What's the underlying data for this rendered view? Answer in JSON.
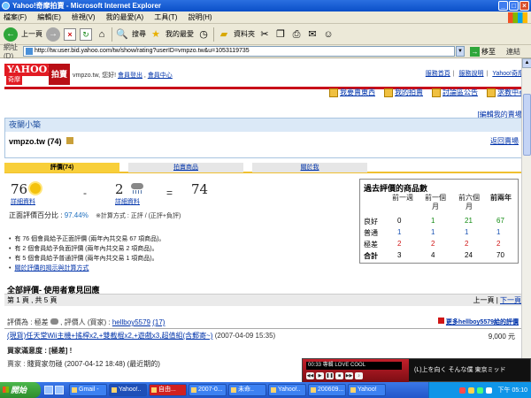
{
  "window": {
    "title": "Yahoo!奇摩拍賣 - Microsoft Internet Explorer",
    "menu": [
      "檔案(F)",
      "編輯(E)",
      "檢視(V)",
      "我的最愛(A)",
      "工具(T)",
      "說明(H)"
    ],
    "toolbar": {
      "back": "上一頁",
      "search": "搜尋",
      "favorites": "我的最愛",
      "history": "資料夾"
    },
    "address": {
      "label": "網址(D)",
      "url": "http://tw.user.bid.yahoo.com/tw/show/rating?userID=vmpzo.tw&u=1053119735",
      "go": "移至",
      "links": "連結"
    }
  },
  "header": {
    "logo_yahoo": "YAHOO!",
    "logo_kimo": "奇摩",
    "logo_auction": "拍賣",
    "hello_prefix": "vmpzo.tw, 您好!",
    "logout": "會員登出",
    "member_center": "會員中心",
    "top_links": [
      "服務首頁",
      "服務說明",
      "Yahoo!奇摩"
    ],
    "nav": [
      "我要賣東西",
      "我的拍賣",
      "討論區公告",
      "求教中心"
    ]
  },
  "store": {
    "edit_store": "[編輯我的賣場]",
    "name": "夜闌小築",
    "seller_id": "vmpzo.tw",
    "seller_score": "(74)",
    "back_link": "返回賣場"
  },
  "tabs": [
    "評價(74)",
    "拍賣商品",
    "關於我"
  ],
  "rating": {
    "positive": "76",
    "negative": "2",
    "total": "74",
    "minus": "-",
    "equals": "=",
    "detail_label": "詳細資料",
    "pct_label": "正面評價百分比 :",
    "pct_value": "97.44%",
    "formula": "※計算方式 : 正評 / (正評+負評)"
  },
  "bullets": [
    "有 76 個會員給予正面評價 (兩年內共交易 67 項商品)。",
    "有 2 個會員給予負面評價 (兩年內共交易 2 項商品)。",
    "有 5 個會員給予普通評價 (兩年內共交易 1 項商品)。",
    "關於評價的揭示與計算方式"
  ],
  "past": {
    "title": "過去評價的商品數",
    "headers": [
      "前一週",
      "前一個月",
      "前六個月",
      "前兩年"
    ],
    "rows": [
      {
        "label": "良好",
        "values": [
          "0",
          "1",
          "21",
          "67"
        ]
      },
      {
        "label": "普通",
        "values": [
          "1",
          "1",
          "1",
          "1"
        ]
      },
      {
        "label": "極差",
        "values": [
          "2",
          "2",
          "2",
          "2"
        ]
      },
      {
        "label": "合計",
        "values": [
          "3",
          "4",
          "24",
          "70"
        ]
      }
    ]
  },
  "reviews": {
    "section_title": "全部評價- 使用者意見回應",
    "pages": "第 1 頁 , 共 5 頁",
    "prev": "上一頁",
    "next": "下一頁",
    "rating_label": "評價為 :",
    "rating_value": "極差",
    "rater_label": ", 評價人 (買家) :",
    "buyer": "hellboy5579",
    "buyer_score": "(17)",
    "more_link": "更多hellboy5579給的評價",
    "item": "(現貨)任天堂Wii主機+搖桿x2,+雙截棍x2,+遊戲x3,超值組(含郵寄~)",
    "item_date": "(2007-04-09 15:35)",
    "price": "9,000 元",
    "satisfaction_label": "買家滿意度 :",
    "satisfaction_value": "[極差] !",
    "reply_label": "賣家 :",
    "reply_text": "賤買家勿碰 (2007-04-12 18:48) (最近期的)"
  },
  "player": {
    "track": "00:33 專輯 LOVE COOL",
    "ticker": "(L)上を向く そんな僕 東京ミッド"
  },
  "taskbar": {
    "start": "開始",
    "tasks": [
      "Gmail -",
      "Yahoo!..",
      "自由...",
      "2007-0...",
      "未命..",
      "Yahoo!..",
      "200609...",
      "Yahoo!"
    ],
    "clock": "下午 05:10"
  }
}
